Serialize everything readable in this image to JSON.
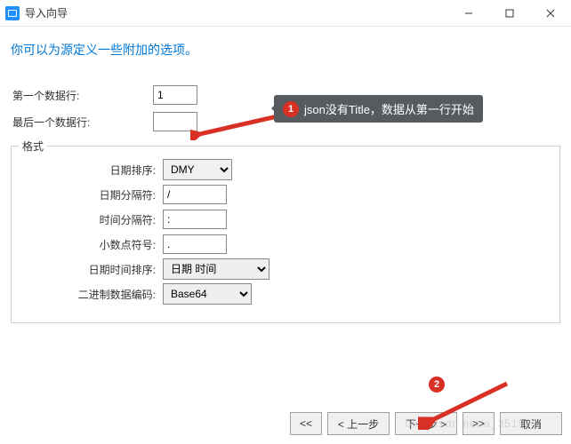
{
  "window": {
    "title": "导入向导"
  },
  "headline": "你可以为源定义一些附加的选项。",
  "upper": {
    "first_row_label": "第一个数据行:",
    "first_row_value": "1",
    "last_row_label": "最后一个数据行:",
    "last_row_value": ""
  },
  "format": {
    "legend": "格式",
    "date_order_label": "日期排序:",
    "date_order_value": "DMY",
    "date_sep_label": "日期分隔符:",
    "date_sep_value": "/",
    "time_sep_label": "时间分隔符:",
    "time_sep_value": ":",
    "decimal_label": "小数点符号:",
    "decimal_value": ".",
    "datetime_order_label": "日期时间排序:",
    "datetime_order_value": "日期 时间",
    "binary_label": "二进制数据编码:",
    "binary_value": "Base64"
  },
  "buttons": {
    "first": "<<",
    "prev": "<  上一步",
    "next": "下一步  >",
    "last": ">>",
    "cancel": "取消"
  },
  "annot": {
    "tip1_num": "1",
    "tip1_text": "json没有Title，数据从第一行开始",
    "tip2_num": "2"
  },
  "watermark": "blog.csdn.net/a_35197"
}
